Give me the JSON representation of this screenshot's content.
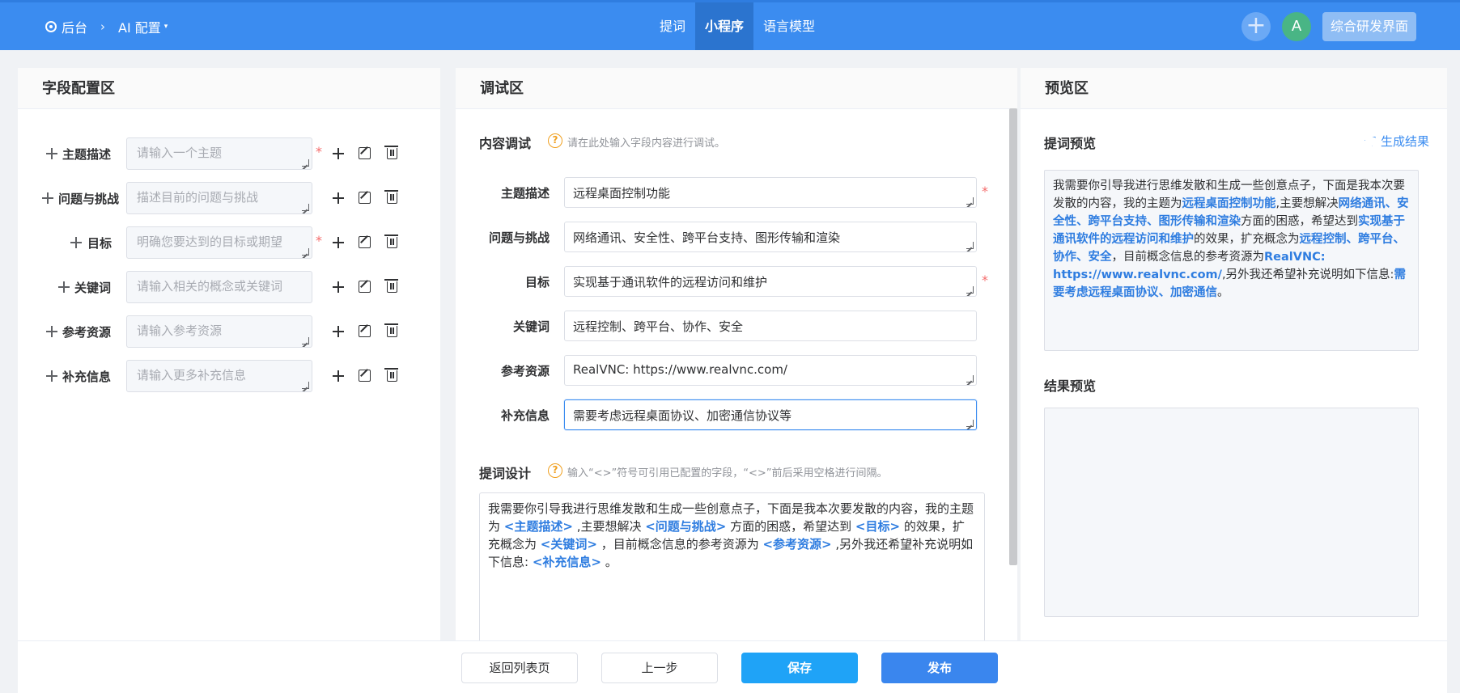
{
  "header": {
    "breadcrumb_home": "后台",
    "breadcrumb_current": "AI 配置",
    "tabs": [
      {
        "label": "提词",
        "active": false
      },
      {
        "label": "小程序",
        "active": true
      },
      {
        "label": "语言模型",
        "active": false
      }
    ],
    "avatar_letter": "A",
    "env_button": "综合研发界面"
  },
  "field_panel": {
    "title": "字段配置区",
    "fields": [
      {
        "label": "主题描述",
        "placeholder": "请输入一个主题",
        "required": true
      },
      {
        "label": "问题与挑战",
        "placeholder": "描述目前的问题与挑战",
        "required": false
      },
      {
        "label": "目标",
        "placeholder": "明确您要达到的目标或期望",
        "required": true
      },
      {
        "label": "关键词",
        "placeholder": "请输入相关的概念或关键词",
        "required": false
      },
      {
        "label": "参考资源",
        "placeholder": "请输入参考资源",
        "required": false
      },
      {
        "label": "补充信息",
        "placeholder": "请输入更多补充信息",
        "required": false
      }
    ]
  },
  "debug_panel": {
    "title": "调试区",
    "content_debug": {
      "title": "内容调试",
      "hint": "请在此处输入字段内容进行调试。"
    },
    "inputs": [
      {
        "label": "主题描述",
        "value": "远程桌面控制功能",
        "required": true
      },
      {
        "label": "问题与挑战",
        "value": "网络通讯、安全性、跨平台支持、图形传输和渲染",
        "required": false
      },
      {
        "label": "目标",
        "value": "实现基于通讯软件的远程访问和维护",
        "required": true
      },
      {
        "label": "关键词",
        "value": "远程控制、跨平台、协作、安全",
        "required": false
      },
      {
        "label": "参考资源",
        "value": "RealVNC: https://www.realvnc.com/",
        "required": false
      },
      {
        "label": "补充信息",
        "value": "需要考虑远程桌面协议、加密通信协议等",
        "required": false
      }
    ],
    "prompt_design": {
      "title": "提词设计",
      "hint": "输入“<>”符号可引用已配置的字段，“<>”前后采用空格进行间隔。",
      "segments": [
        {
          "text": "我需要你引导我进行思维发散和生成一些创意点子，下面是我本次要发散的内容，我的主题为 ",
          "token": false
        },
        {
          "text": "<主题描述>",
          "token": true
        },
        {
          "text": " ,主要想解决 ",
          "token": false
        },
        {
          "text": "<问题与挑战>",
          "token": true
        },
        {
          "text": " 方面的困惑，希望达到 ",
          "token": false
        },
        {
          "text": "<目标>",
          "token": true
        },
        {
          "text": " 的效果，扩充概念为 ",
          "token": false
        },
        {
          "text": "<关键词>",
          "token": true
        },
        {
          "text": " ，目前概念信息的参考资源为 ",
          "token": false
        },
        {
          "text": "<参考资源>",
          "token": true
        },
        {
          "text": " ,另外我还希望补充说明如下信息: ",
          "token": false
        },
        {
          "text": "<补充信息>",
          "token": true
        },
        {
          "text": " 。",
          "token": false
        }
      ]
    }
  },
  "preview_panel": {
    "title": "预览区",
    "prompt_preview_title": "提词预览",
    "generate_link": "生成结果",
    "prompt_preview_segments": [
      {
        "text": "我需要你引导我进行思维发散和生成一些创意点子，下面是我本次要发散的内容，我的主题为",
        "hl": false
      },
      {
        "text": "远程桌面控制功能",
        "hl": true
      },
      {
        "text": ",主要想解决",
        "hl": false
      },
      {
        "text": "网络通讯、安全性、跨平台支持、图形传输和渲染",
        "hl": true
      },
      {
        "text": "方面的困惑，希望达到",
        "hl": false
      },
      {
        "text": "实现基于通讯软件的远程访问和维护",
        "hl": true
      },
      {
        "text": "的效果，扩充概念为",
        "hl": false
      },
      {
        "text": "远程控制、跨平台、协作、安全",
        "hl": true
      },
      {
        "text": "，目前概念信息的参考资源为",
        "hl": false
      },
      {
        "text": "RealVNC: https://www.realvnc.com/",
        "hl": true
      },
      {
        "text": ",另外我还希望补充说明如下信息:",
        "hl": false
      },
      {
        "text": "需要考虑远程桌面协议、加密通信",
        "hl": true
      },
      {
        "text": "。",
        "hl": false
      }
    ],
    "result_preview_title": "结果预览"
  },
  "footer": {
    "back_label": "返回列表页",
    "prev_label": "上一步",
    "save_label": "保存",
    "publish_label": "发布"
  }
}
